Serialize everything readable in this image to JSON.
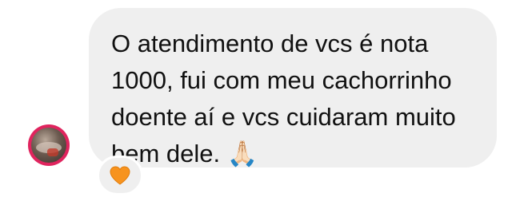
{
  "message": {
    "text": "O atendimento de vcs é nota\n1000, fui com meu cachorrinho\ndoente aí e vcs cuidaram muito\nbem dele. 🙏🏻"
  },
  "reaction": {
    "icon": "orange-heart-icon",
    "color": "#f7931e"
  },
  "avatar": {
    "ring_color": "#e0245e"
  },
  "bubble": {
    "background": "#efefef"
  }
}
